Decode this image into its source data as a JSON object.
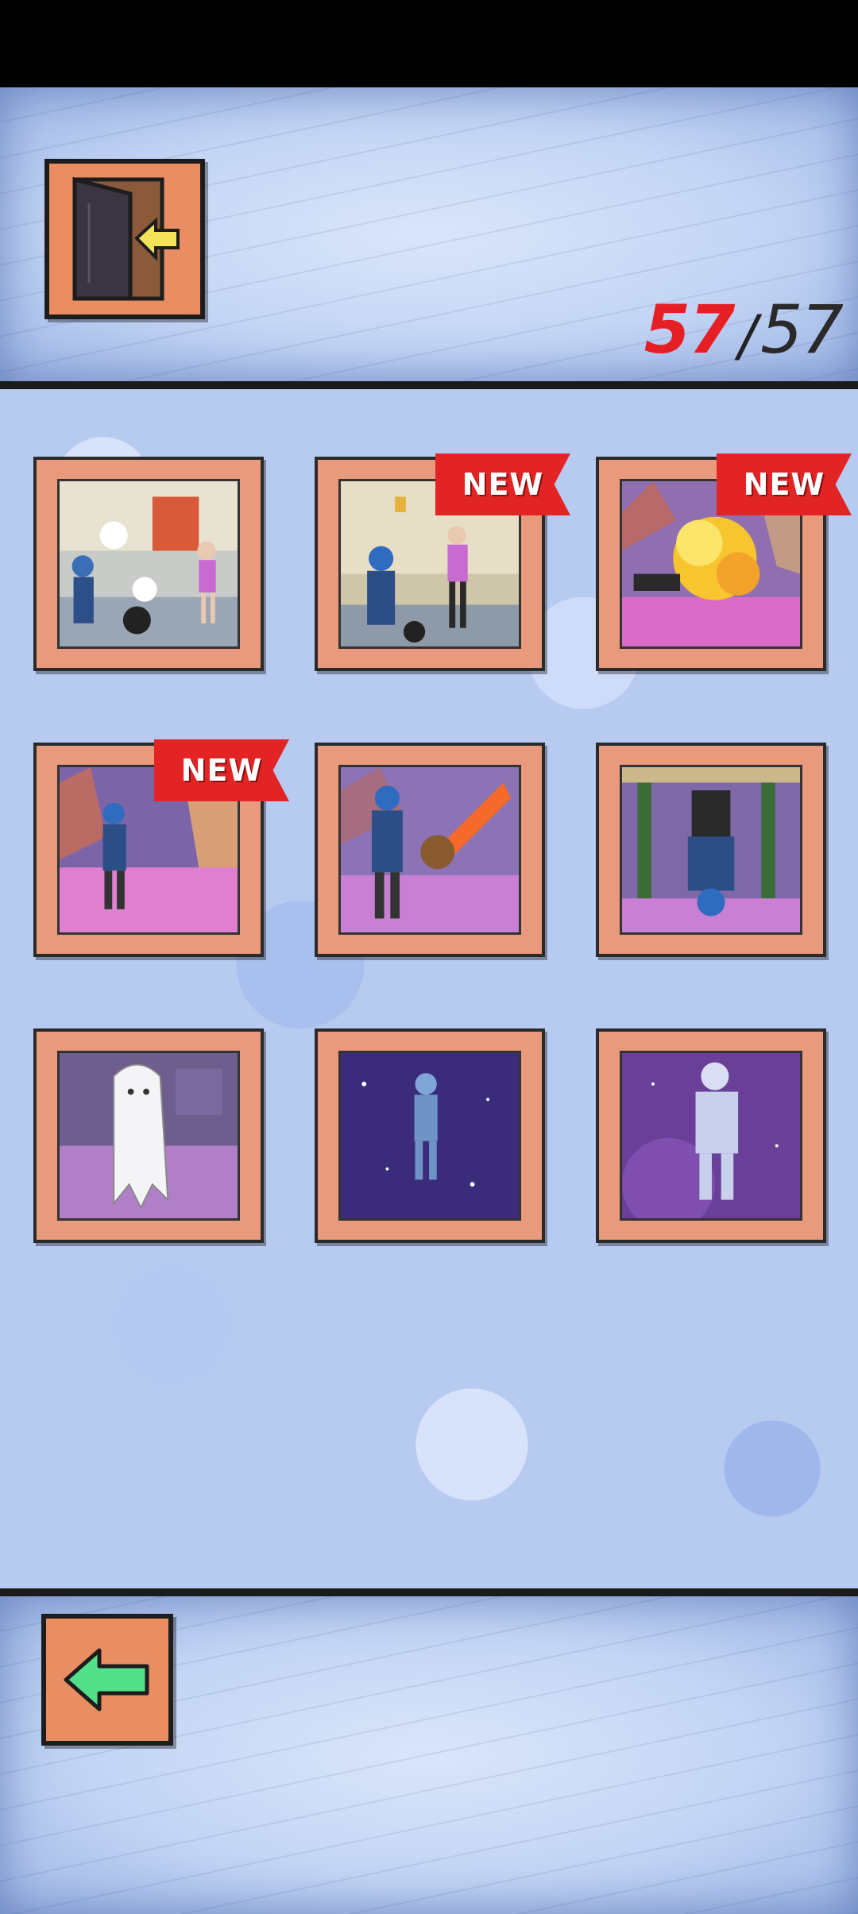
{
  "counter": {
    "current": "57",
    "separator": "/",
    "total": "57"
  },
  "buttons": {
    "exit": "exit-door-icon",
    "back": "arrow-left-icon"
  },
  "badge_label": "NEW",
  "scenes": [
    {
      "id": "scene-1",
      "is_new": false,
      "desc": "kitchen-dishes"
    },
    {
      "id": "scene-2",
      "is_new": true,
      "desc": "kitchen-woman"
    },
    {
      "id": "scene-3",
      "is_new": true,
      "desc": "explosion"
    },
    {
      "id": "scene-4",
      "is_new": true,
      "desc": "canyon-walk"
    },
    {
      "id": "scene-5",
      "is_new": false,
      "desc": "meteor"
    },
    {
      "id": "scene-6",
      "is_new": false,
      "desc": "upside-down"
    },
    {
      "id": "scene-7",
      "is_new": false,
      "desc": "ghost"
    },
    {
      "id": "scene-8",
      "is_new": false,
      "desc": "space-figure"
    },
    {
      "id": "scene-9",
      "is_new": false,
      "desc": "crystal-figure"
    }
  ],
  "colors": {
    "accent_red": "#e32425",
    "frame": "#ea9a7c",
    "arrow_green": "#52e08a"
  }
}
